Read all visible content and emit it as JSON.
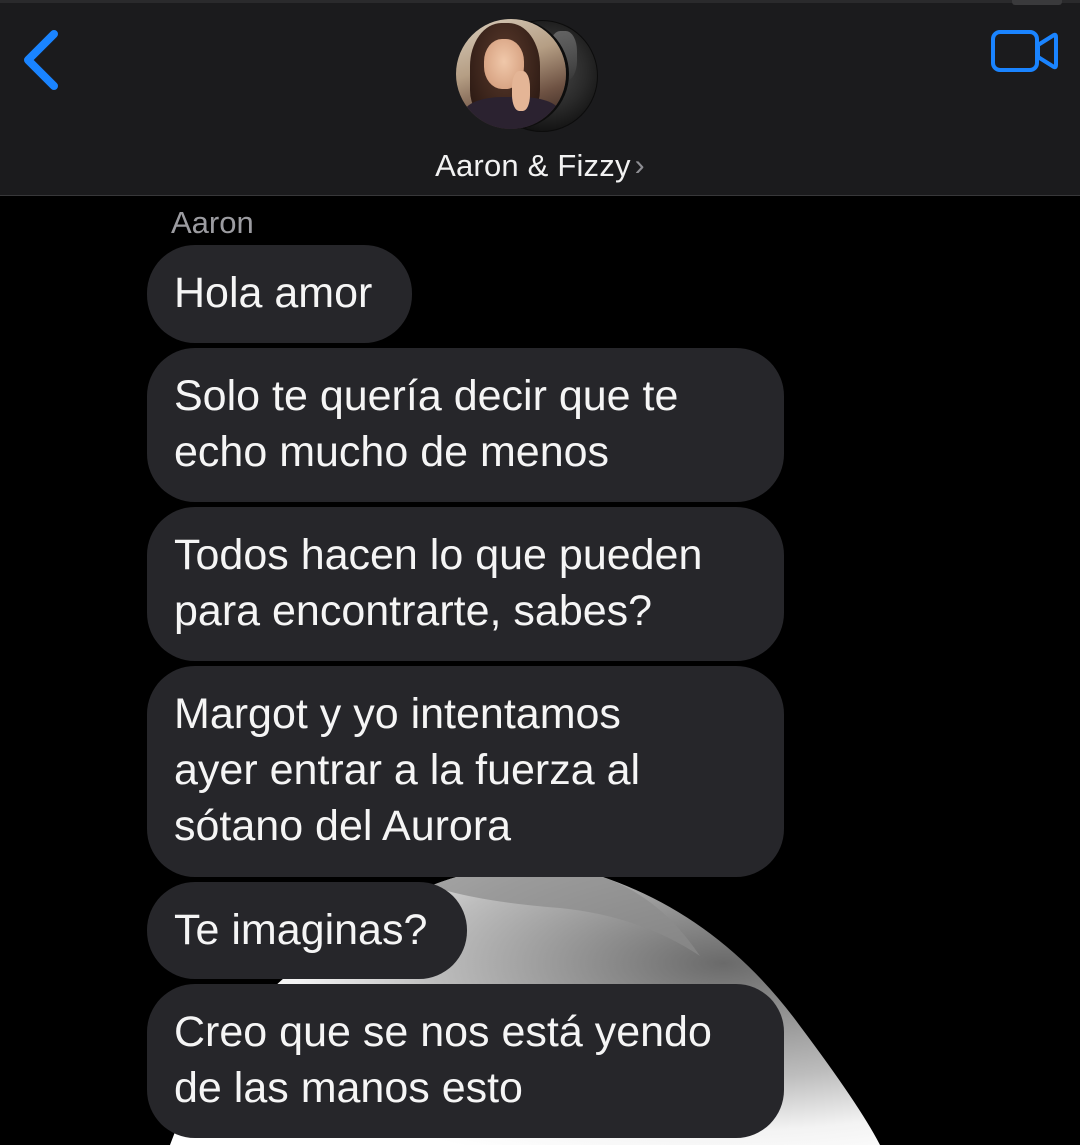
{
  "header": {
    "back_icon": "chevron-left-icon",
    "video_icon": "video-camera-icon",
    "group_name": "Aaron & Fizzy",
    "name_chevron": "›",
    "accent_color": "#1a84ff"
  },
  "conversation": {
    "sender": "Aaron",
    "bubble_color": "#26262a",
    "messages": [
      {
        "text": "Hola amor"
      },
      {
        "text": "Solo te quería decir que te\necho mucho de menos"
      },
      {
        "text": "Todos hacen lo que pueden\npara encontrarte, sabes?"
      },
      {
        "text": "Margot y yo intentamos\nayer entrar a la fuerza al\nsótano del Aurora"
      },
      {
        "text": "Te imaginas?"
      },
      {
        "text": "Creo que se nos está yendo\nde las manos esto"
      }
    ]
  }
}
